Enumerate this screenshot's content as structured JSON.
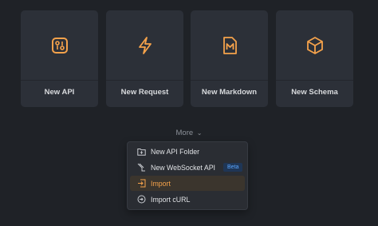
{
  "cards": [
    {
      "label": "New API",
      "icon": "api-icon"
    },
    {
      "label": "New Request",
      "icon": "lightning-icon"
    },
    {
      "label": "New Markdown",
      "icon": "markdown-icon"
    },
    {
      "label": "New Schema",
      "icon": "cube-icon"
    }
  ],
  "more_label": "More",
  "menu": {
    "items": [
      {
        "label": "New API Folder",
        "icon": "folder-plus-icon"
      },
      {
        "label": "New WebSocket API",
        "icon": "websocket-icon",
        "badge": "Beta"
      },
      {
        "label": "Import",
        "icon": "import-icon",
        "active": true
      },
      {
        "label": "Import cURL",
        "icon": "curl-icon"
      }
    ]
  },
  "colors": {
    "accent": "#f5a24b",
    "background": "#1f2227",
    "card": "#2c3038",
    "badge_text": "#5aa6ff"
  }
}
